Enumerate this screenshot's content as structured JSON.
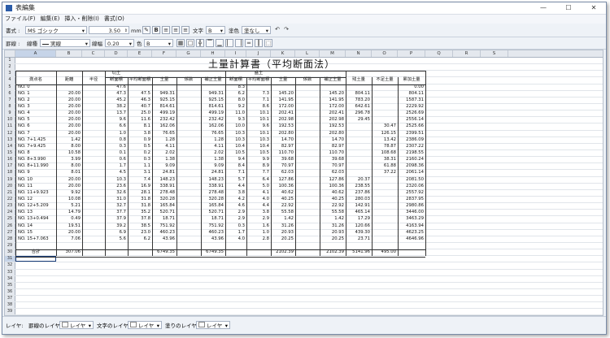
{
  "window": {
    "title": "表編集",
    "minimize": "—",
    "maximize": "☐",
    "close": "✕"
  },
  "menu": [
    "ファイル(F)",
    "編集(E)",
    "挿入・削除(I)",
    "書式(O)"
  ],
  "toolbar1": {
    "font_label": "書式 :",
    "font_name": "MS ゴシック",
    "font_size": "3.50",
    "size_unit": "mm",
    "text_label": "文字",
    "text_value": "B",
    "color_label": "塗色",
    "color_value": "塗なし"
  },
  "toolbar2": {
    "line_label": "罫線 :",
    "line_type_label": "線種",
    "line_type_value": "実線",
    "line_width_label": "線幅",
    "line_width_value": "0.20",
    "color_label": "色",
    "color_value": "B"
  },
  "columns": [
    "A",
    "B",
    "C",
    "D",
    "E",
    "F",
    "G",
    "H",
    "I",
    "J",
    "K",
    "L",
    "M",
    "N",
    "O",
    "P",
    "Q",
    "R",
    "S"
  ],
  "sheet": {
    "title": "土量計算書（平均断面法）",
    "header": {
      "station": "測点名",
      "distance": "距離",
      "half_width": "半径",
      "cut": "切土",
      "fill": "盛土",
      "cut_area": "断面積",
      "cut_avg": "平均断面積",
      "cut_vol": "土量",
      "cut_coef": "係数",
      "cut_adj": "補正土量",
      "fill_area": "断面積",
      "fill_avg": "平均断面積",
      "fill_vol": "土量",
      "fill_coef": "係数",
      "fill_adj": "補正土量",
      "balance": "残土量",
      "shortage": "不足土量",
      "cumulative": "累加土量"
    },
    "rows": [
      [
        "NO. 0",
        "",
        "",
        "47.6",
        "",
        "",
        "",
        "",
        "8.3",
        "",
        "",
        "",
        "",
        "",
        "",
        "0.00"
      ],
      [
        "NO. 1",
        "20.00",
        "",
        "47.3",
        "47.5",
        "949.31",
        "",
        "949.31",
        "6.2",
        "7.3",
        "145.20",
        "",
        "145.20",
        "804.11",
        "",
        "804.11"
      ],
      [
        "NO. 2",
        "20.00",
        "",
        "45.2",
        "46.3",
        "925.15",
        "",
        "925.15",
        "8.0",
        "7.1",
        "141.95",
        "",
        "141.95",
        "783.20",
        "",
        "1587.31"
      ],
      [
        "NO. 3",
        "20.00",
        "",
        "38.2",
        "40.7",
        "814.61",
        "",
        "814.61",
        "9.2",
        "8.6",
        "172.00",
        "",
        "172.00",
        "642.61",
        "",
        "2229.92"
      ],
      [
        "NO. 4",
        "20.00",
        "",
        "13.7",
        "25.0",
        "499.19",
        "",
        "499.19",
        "11.0",
        "10.1",
        "202.41",
        "",
        "202.41",
        "296.78",
        "",
        "2526.69"
      ],
      [
        "NO. 5",
        "20.00",
        "",
        "9.6",
        "11.6",
        "232.42",
        "",
        "232.42",
        "9.3",
        "10.1",
        "202.98",
        "",
        "202.98",
        "29.45",
        "",
        "2556.14"
      ],
      [
        "NO. 6",
        "20.00",
        "",
        "6.6",
        "8.1",
        "162.06",
        "",
        "162.06",
        "10.0",
        "9.6",
        "192.53",
        "",
        "192.53",
        "",
        "30.47",
        "2525.66"
      ],
      [
        "NO. 7",
        "20.00",
        "",
        "1.0",
        "3.8",
        "76.65",
        "",
        "76.65",
        "10.3",
        "10.1",
        "202.80",
        "",
        "202.80",
        "",
        "126.15",
        "2399.51"
      ],
      [
        "NO. 7+1.425",
        "1.42",
        "",
        "0.8",
        "0.9",
        "1.28",
        "",
        "1.28",
        "10.3",
        "10.3",
        "14.70",
        "",
        "14.70",
        "",
        "13.42",
        "2386.09"
      ],
      [
        "NO. 7+9.425",
        "8.00",
        "",
        "0.3",
        "0.5",
        "4.11",
        "",
        "4.11",
        "10.4",
        "10.4",
        "82.97",
        "",
        "82.97",
        "",
        "78.87",
        "2307.22"
      ],
      [
        "NO. 8",
        "10.58",
        "",
        "0.1",
        "0.2",
        "2.02",
        "",
        "2.02",
        "10.5",
        "10.5",
        "110.70",
        "",
        "110.70",
        "",
        "108.68",
        "2198.55"
      ],
      [
        "NO. 8+3.990",
        "3.99",
        "",
        "0.6",
        "0.3",
        "1.38",
        "",
        "1.38",
        "9.4",
        "9.9",
        "39.68",
        "",
        "39.68",
        "",
        "38.31",
        "2160.24"
      ],
      [
        "NO. 8+11.990",
        "8.00",
        "",
        "1.7",
        "1.1",
        "9.09",
        "",
        "9.09",
        "8.4",
        "8.9",
        "70.97",
        "",
        "70.97",
        "",
        "61.88",
        "2098.36"
      ],
      [
        "NO. 9",
        "8.01",
        "",
        "4.5",
        "3.1",
        "24.81",
        "",
        "24.81",
        "7.1",
        "7.7",
        "62.03",
        "",
        "62.03",
        "",
        "37.22",
        "2061.14"
      ],
      [
        "NO. 10",
        "20.00",
        "",
        "10.3",
        "7.4",
        "148.23",
        "",
        "148.23",
        "5.7",
        "6.4",
        "127.86",
        "",
        "127.86",
        "20.37",
        "",
        "2081.50"
      ],
      [
        "NO. 11",
        "20.00",
        "",
        "23.6",
        "16.9",
        "338.91",
        "",
        "338.91",
        "4.4",
        "5.0",
        "100.36",
        "",
        "100.36",
        "238.55",
        "",
        "2320.06"
      ],
      [
        "NO. 11+9.923",
        "9.92",
        "",
        "32.6",
        "28.1",
        "278.48",
        "",
        "278.48",
        "3.8",
        "4.1",
        "40.62",
        "",
        "40.62",
        "237.86",
        "",
        "2557.92"
      ],
      [
        "NO. 12",
        "10.08",
        "",
        "31.0",
        "31.8",
        "320.28",
        "",
        "320.28",
        "4.2",
        "4.0",
        "40.25",
        "",
        "40.25",
        "280.03",
        "",
        "2837.95"
      ],
      [
        "NO. 12+5.209",
        "5.21",
        "",
        "32.7",
        "31.8",
        "165.84",
        "",
        "165.84",
        "4.6",
        "4.4",
        "22.92",
        "",
        "22.92",
        "142.91",
        "",
        "2980.86"
      ],
      [
        "NO. 13",
        "14.79",
        "",
        "37.7",
        "35.2",
        "520.71",
        "",
        "520.71",
        "2.9",
        "3.8",
        "55.58",
        "",
        "55.58",
        "465.14",
        "",
        "3446.00"
      ],
      [
        "NO. 13+0.494",
        "0.49",
        "",
        "37.9",
        "37.8",
        "18.71",
        "",
        "18.71",
        "2.9",
        "2.9",
        "1.42",
        "",
        "1.42",
        "17.29",
        "",
        "3463.29"
      ],
      [
        "NO. 14",
        "19.51",
        "",
        "39.2",
        "38.5",
        "751.92",
        "",
        "751.92",
        "0.3",
        "1.6",
        "31.26",
        "",
        "31.26",
        "120.66",
        "",
        "4163.94"
      ],
      [
        "NO. 15",
        "20.00",
        "",
        "6.9",
        "23.0",
        "460.23",
        "",
        "460.23",
        "1.7",
        "1.0",
        "20.93",
        "",
        "20.93",
        "439.30",
        "",
        "4623.25"
      ],
      [
        "NO. 15+7.063",
        "7.06",
        "",
        "5.6",
        "6.2",
        "43.96",
        "",
        "43.96",
        "4.0",
        "2.8",
        "20.25",
        "",
        "20.25",
        "23.71",
        "",
        "4646.96"
      ]
    ],
    "total_label": "合計",
    "total": {
      "distance": "307.06",
      "cut_vol": "6749.35",
      "cut_adj": "6749.35",
      "fill_vol": "2102.39",
      "fill_adj": "2102.39",
      "balance": "5141.96",
      "shortage": "495.00"
    }
  },
  "statusbar": {
    "layer_label": "レイヤ:",
    "line_layer_label": "罫線のレイヤ",
    "line_layer_value": "レイヤ",
    "text_layer_label": "文字のレイヤ",
    "text_layer_value": "レイヤ",
    "fill_layer_label": "塗りのレイヤ",
    "fill_layer_value": "レイヤ"
  }
}
